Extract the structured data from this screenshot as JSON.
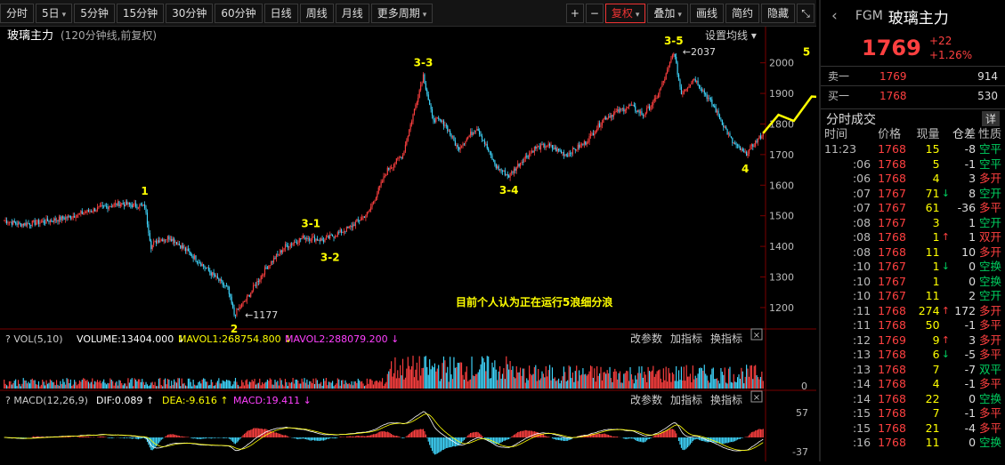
{
  "toolbar": {
    "items": [
      "分时",
      "5日",
      "5分钟",
      "15分钟",
      "30分钟",
      "60分钟",
      "日线",
      "周线",
      "月线",
      "更多周期"
    ],
    "right": [
      "+",
      "−",
      "复权",
      "叠加",
      "画线",
      "简约",
      "隐藏"
    ]
  },
  "main_header": {
    "title": "玻璃主力",
    "subtitle": "(120分钟线,前复权)",
    "setting": "设置均线"
  },
  "vol_header": {
    "label": "VOL(5,10)",
    "volume": "VOLUME:13404.000",
    "mavol1": "MAVOL1:268754.800",
    "mavol2": "MAVOL2:288079.200",
    "ops": [
      "改参数",
      "加指标",
      "换指标"
    ]
  },
  "macd_header": {
    "label": "MACD(12,26,9)",
    "dif": "DIF:0.089",
    "dea": "DEA:-9.616",
    "macd": "MACD:19.411",
    "ops": [
      "改参数",
      "加指标",
      "换指标"
    ]
  },
  "colors": {
    "up": "#ff4040",
    "down": "#40d8ff",
    "wave": "#ffff00",
    "bg": "#000000"
  },
  "chart_data": {
    "type": "candlestick",
    "title": "玻璃主力",
    "yticks": [
      2000,
      1900,
      1800,
      1700,
      1600,
      1500,
      1400,
      1300,
      1200
    ],
    "ylim": [
      1130,
      2060
    ],
    "waypoints": [
      [
        0,
        1485
      ],
      [
        12,
        1472
      ],
      [
        30,
        1480
      ],
      [
        50,
        1495
      ],
      [
        70,
        1520
      ],
      [
        90,
        1540
      ],
      [
        110,
        1530
      ],
      [
        115,
        1400
      ],
      [
        120,
        1420
      ],
      [
        130,
        1430
      ],
      [
        150,
        1360
      ],
      [
        175,
        1260
      ],
      [
        180,
        1177
      ],
      [
        190,
        1230
      ],
      [
        205,
        1330
      ],
      [
        220,
        1400
      ],
      [
        235,
        1430
      ],
      [
        250,
        1420
      ],
      [
        270,
        1460
      ],
      [
        285,
        1510
      ],
      [
        300,
        1650
      ],
      [
        312,
        1700
      ],
      [
        320,
        1830
      ],
      [
        328,
        1960
      ],
      [
        335,
        1820
      ],
      [
        345,
        1800
      ],
      [
        355,
        1720
      ],
      [
        370,
        1790
      ],
      [
        385,
        1660
      ],
      [
        395,
        1630
      ],
      [
        405,
        1680
      ],
      [
        415,
        1720
      ],
      [
        425,
        1730
      ],
      [
        440,
        1700
      ],
      [
        455,
        1740
      ],
      [
        470,
        1820
      ],
      [
        490,
        1860
      ],
      [
        500,
        1830
      ],
      [
        510,
        1880
      ],
      [
        518,
        1960
      ],
      [
        524,
        2037
      ],
      [
        530,
        1900
      ],
      [
        540,
        1950
      ],
      [
        555,
        1860
      ],
      [
        570,
        1740
      ],
      [
        580,
        1700
      ],
      [
        594,
        1770
      ]
    ],
    "annotations": [
      {
        "text": "1",
        "x": 110,
        "y": 1545
      },
      {
        "text": "2",
        "x": 180,
        "y": 1177
      },
      {
        "text": "3-1",
        "x": 240,
        "y": 1440
      },
      {
        "text": "3-2",
        "x": 255,
        "y": 1410
      },
      {
        "text": "3-3",
        "x": 328,
        "y": 1965
      },
      {
        "text": "3-4",
        "x": 395,
        "y": 1630
      },
      {
        "text": "3-5",
        "x": 524,
        "y": 2037
      },
      {
        "text": "4",
        "x": 580,
        "y": 1700
      },
      {
        "text": "5",
        "x": 628,
        "y": 2000
      }
    ],
    "max_label": "2037",
    "min_label": "1177",
    "note": "目前个人认为正在运行5浪细分浪",
    "projection": [
      [
        594,
        1770
      ],
      [
        606,
        1830
      ],
      [
        618,
        1810
      ],
      [
        632,
        1890
      ],
      [
        647,
        1885
      ],
      [
        660,
        1930
      ]
    ],
    "vol_ticks": [
      "0"
    ],
    "macd_ticks": [
      "57",
      "-37"
    ]
  },
  "quote": {
    "code": "FGM",
    "name": "玻璃主力",
    "last": "1769",
    "chg": "+22",
    "pct": "+1.26%",
    "ask": {
      "label": "卖一",
      "price": "1769",
      "vol": "914"
    },
    "bid": {
      "label": "买一",
      "price": "1768",
      "vol": "530"
    },
    "ticks_title": "分时成交",
    "ticks_more": "详",
    "cols": [
      "时间",
      "价格",
      "现量",
      "仓差",
      "性质"
    ],
    "ticks": [
      {
        "t": "11:23",
        "p": "1768",
        "v": "15",
        "a": "",
        "d": "-8",
        "n": "空平",
        "pc": "red",
        "nc": "grn"
      },
      {
        "t": ":06",
        "p": "1768",
        "v": "5",
        "a": "",
        "d": "-1",
        "n": "空平",
        "pc": "red",
        "nc": "grn"
      },
      {
        "t": ":06",
        "p": "1768",
        "v": "4",
        "a": "",
        "d": "3",
        "n": "多开",
        "pc": "red",
        "nc": "red"
      },
      {
        "t": ":07",
        "p": "1767",
        "v": "71",
        "a": "↓",
        "d": "8",
        "n": "空开",
        "pc": "red",
        "nc": "grn"
      },
      {
        "t": ":07",
        "p": "1767",
        "v": "61",
        "a": "",
        "d": "-36",
        "n": "多平",
        "pc": "red",
        "nc": "red"
      },
      {
        "t": ":08",
        "p": "1767",
        "v": "3",
        "a": "",
        "d": "1",
        "n": "空开",
        "pc": "red",
        "nc": "grn"
      },
      {
        "t": ":08",
        "p": "1768",
        "v": "1",
        "a": "↑",
        "d": "1",
        "n": "双开",
        "pc": "red",
        "nc": "red"
      },
      {
        "t": ":08",
        "p": "1768",
        "v": "11",
        "a": "",
        "d": "10",
        "n": "多开",
        "pc": "red",
        "nc": "red"
      },
      {
        "t": ":10",
        "p": "1767",
        "v": "1",
        "a": "↓",
        "d": "0",
        "n": "空换",
        "pc": "red",
        "nc": "grn"
      },
      {
        "t": ":10",
        "p": "1767",
        "v": "1",
        "a": "",
        "d": "0",
        "n": "空换",
        "pc": "red",
        "nc": "grn"
      },
      {
        "t": ":10",
        "p": "1767",
        "v": "11",
        "a": "",
        "d": "2",
        "n": "空开",
        "pc": "red",
        "nc": "grn"
      },
      {
        "t": ":11",
        "p": "1768",
        "v": "274",
        "a": "↑",
        "d": "172",
        "n": "多开",
        "pc": "red",
        "nc": "red"
      },
      {
        "t": ":11",
        "p": "1768",
        "v": "50",
        "a": "",
        "d": "-1",
        "n": "多平",
        "pc": "red",
        "nc": "red"
      },
      {
        "t": ":12",
        "p": "1769",
        "v": "9",
        "a": "↑",
        "d": "3",
        "n": "多开",
        "pc": "red",
        "nc": "red"
      },
      {
        "t": ":13",
        "p": "1768",
        "v": "6",
        "a": "↓",
        "d": "-5",
        "n": "多平",
        "pc": "red",
        "nc": "red"
      },
      {
        "t": ":13",
        "p": "1768",
        "v": "7",
        "a": "",
        "d": "-7",
        "n": "双平",
        "pc": "red",
        "nc": "grn"
      },
      {
        "t": ":14",
        "p": "1768",
        "v": "4",
        "a": "",
        "d": "-1",
        "n": "多平",
        "pc": "red",
        "nc": "red"
      },
      {
        "t": ":14",
        "p": "1768",
        "v": "22",
        "a": "",
        "d": "0",
        "n": "空换",
        "pc": "red",
        "nc": "grn"
      },
      {
        "t": ":15",
        "p": "1768",
        "v": "7",
        "a": "",
        "d": "-1",
        "n": "多平",
        "pc": "red",
        "nc": "red"
      },
      {
        "t": ":15",
        "p": "1768",
        "v": "21",
        "a": "",
        "d": "-4",
        "n": "多平",
        "pc": "red",
        "nc": "red"
      },
      {
        "t": ":16",
        "p": "1768",
        "v": "11",
        "a": "",
        "d": "0",
        "n": "空换",
        "pc": "red",
        "nc": "grn"
      }
    ]
  }
}
